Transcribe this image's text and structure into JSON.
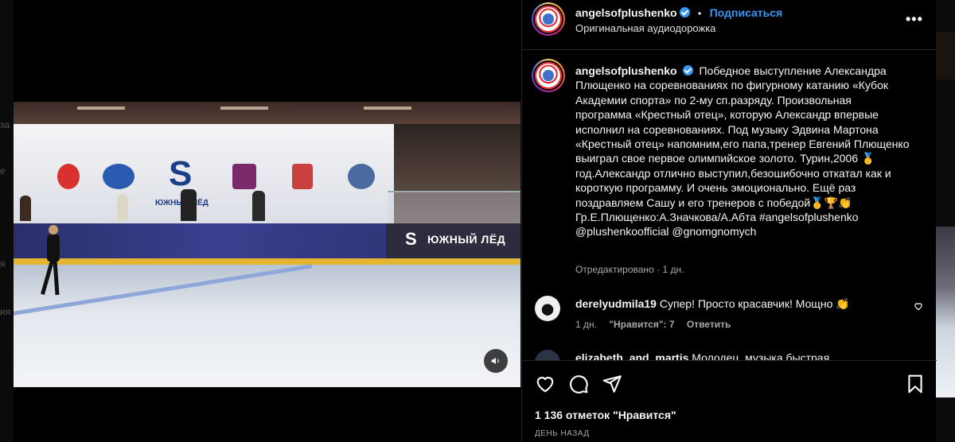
{
  "background_peek": {
    "left_fragments": [
      "за",
      "е",
      "я",
      "ия"
    ]
  },
  "post": {
    "username": "angelsofplushenko",
    "verified": true,
    "separator": "•",
    "follow_label": "Подписаться",
    "audio_label": "Оригинальная аудиодорожка",
    "more_label": "•••",
    "caption": "Победное выступление Александра Плющенко на соревнованиях по фигурному катанию «Кубок Академии спорта» по 2-му сп.разряду. Произвольная программа «Крестный отец», которую Александр впервые исполнил на соревнованиях. Под музыку Эдвина Мартона «Крестный отец» напомним,его папа,тренер Евгений Плющенко выиграл свое первое олимпийское золото. Турин,2006 🥇год.Александр отлично выступил,безошибочно откатал как и короткую программу. И очень эмоционально. Ещё раз поздравляем Сашу и его тренеров с победой🥇🏆👏 Гр.Е.Плющенко:А.Значкова/А.Абта #angelsofplushenko @plushenkoofficial @gnomgnomych",
    "edited_label": "Отредактировано",
    "edited_sep": "·",
    "edited_time": "1 дн.",
    "likes_text": "1 136 отметок \"Нравится\"",
    "posted_when": "ДЕНЬ НАЗАД"
  },
  "video": {
    "sign_s_text": "ЮЖНЫЙ ЛЁД",
    "board_text": "ЮЖНЫЙ ЛЁД"
  },
  "comments": [
    {
      "username": "derelyudmila19",
      "text": "Супер! Просто красавчик! Мощно 👏",
      "time": "1 дн.",
      "likes": "\"Нравится\": 7",
      "reply_label": "Ответить"
    },
    {
      "username": "elizabeth_and_martis",
      "text": "Молодец, музыка быстрая"
    }
  ],
  "colors": {
    "accent": "#3897f0",
    "background": "#000000",
    "muted_text": "#a8a8a8",
    "divider": "#262626"
  },
  "icons": {
    "like": "heart-icon",
    "comment": "comment-icon",
    "share": "paper-plane-icon",
    "save": "bookmark-icon",
    "sound": "speaker-icon",
    "options": "more-icon"
  }
}
